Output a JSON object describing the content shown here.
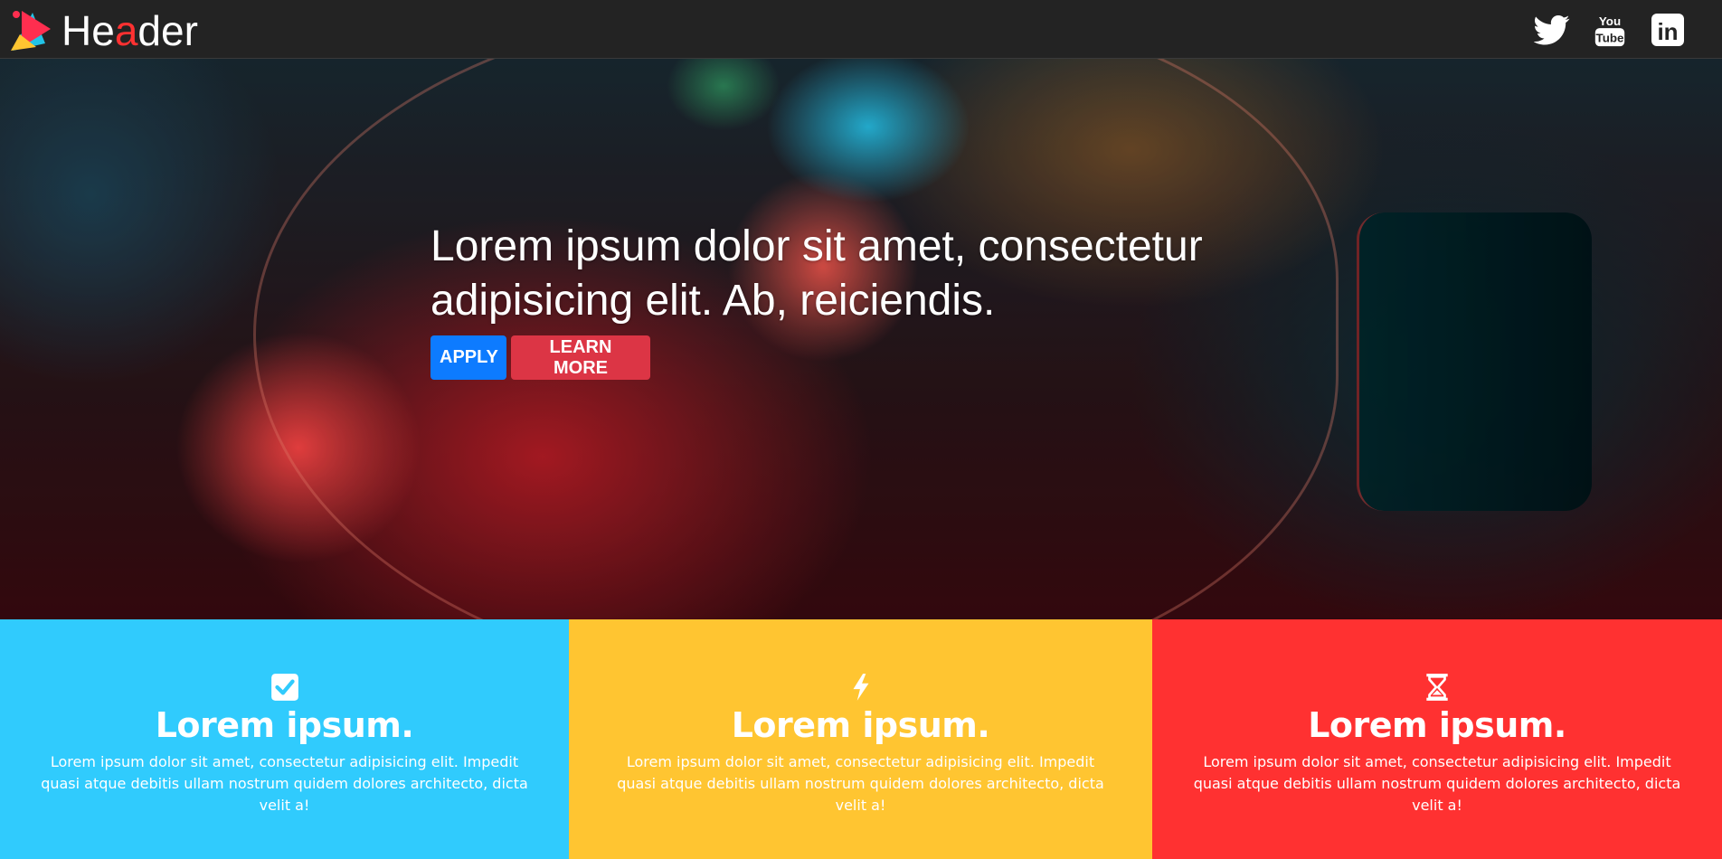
{
  "header": {
    "brand": {
      "prefix": "He",
      "accent": "a",
      "suffix": "der"
    },
    "socials": [
      {
        "icon": "twitter-icon"
      },
      {
        "icon": "youtube-icon",
        "top": "You",
        "bottom": "Tube"
      },
      {
        "icon": "linkedin-icon",
        "label": "in"
      }
    ]
  },
  "hero": {
    "title": "Lorem ipsum dolor sit amet, consectetur adipisicing elit. Ab, reiciendis.",
    "apply_label": "APPLY",
    "learn_more_label": "LEARN MORE"
  },
  "features": [
    {
      "icon": "checkbox-icon",
      "color": "#30cbfd",
      "title": "Lorem ipsum.",
      "text": "Lorem ipsum dolor sit amet, consectetur adipisicing elit. Impedit quasi atque debitis ullam nostrum quidem dolores architecto, dicta velit a!"
    },
    {
      "icon": "lightning-icon",
      "color": "#ffc531",
      "title": "Lorem ipsum.",
      "text": "Lorem ipsum dolor sit amet, consectetur adipisicing elit. Impedit quasi atque debitis ullam nostrum quidem dolores architecto, dicta velit a!"
    },
    {
      "icon": "hourglass-icon",
      "color": "#ff3131",
      "title": "Lorem ipsum.",
      "text": "Lorem ipsum dolor sit amet, consectetur adipisicing elit. Impedit quasi atque debitis ullam nostrum quidem dolores architecto, dicta velit a!"
    }
  ],
  "colors": {
    "header_bg": "#232323",
    "brand_accent": "#ff3131",
    "apply_button": "#0d7bff",
    "learn_more_button": "#dc3545"
  }
}
